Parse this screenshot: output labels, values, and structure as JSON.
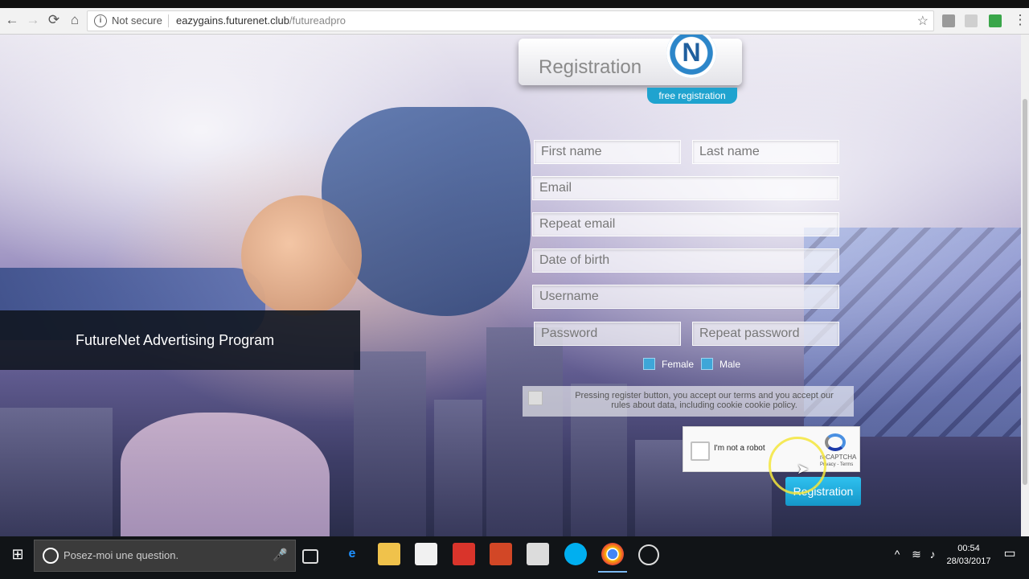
{
  "browser": {
    "security_label": "Not secure",
    "url_host": "eazygains.futurenet.club",
    "url_path": "/futureadpro",
    "back_glyph": "←",
    "forward_glyph": "→",
    "reload_glyph": "⟳",
    "home_glyph": "⌂",
    "star_glyph": "☆",
    "menu_glyph": "⋮",
    "info_glyph": "i"
  },
  "banner": {
    "text": "FutureNet Advertising Program"
  },
  "registration": {
    "title": "Registration",
    "logo_letter": "N",
    "badge": "free registration",
    "fields": {
      "first_name": "First name",
      "last_name": "Last name",
      "email": "Email",
      "repeat_email": "Repeat email",
      "date_of_birth": "Date of birth",
      "username": "Username",
      "password": "Password",
      "repeat_password": "Repeat password"
    },
    "gender": {
      "female": "Female",
      "male": "Male"
    },
    "terms": "Pressing register button, you accept our terms and you accept our rules about data, including cookie cookie policy.",
    "captcha": {
      "label": "I'm not a robot",
      "brand": "reCAPTCHA",
      "links": "Privacy - Terms"
    },
    "submit": "Registration"
  },
  "taskbar": {
    "search_placeholder": "Posez-moi une question.",
    "time": "00:54",
    "date": "28/03/2017",
    "start_glyph": "⊞",
    "mic_glyph": "🎤",
    "icons": [
      "task-view-icon",
      "edge-icon",
      "file-explorer-icon",
      "store-icon",
      "mail-icon",
      "powerpoint-icon",
      "files-icon",
      "skype-icon",
      "chrome-icon",
      "recorder-icon"
    ]
  },
  "colors": {
    "accent": "#1fa3cf",
    "button": "#1597c9",
    "banner_bg": "#0f141e",
    "taskbar_bg": "#111417"
  }
}
